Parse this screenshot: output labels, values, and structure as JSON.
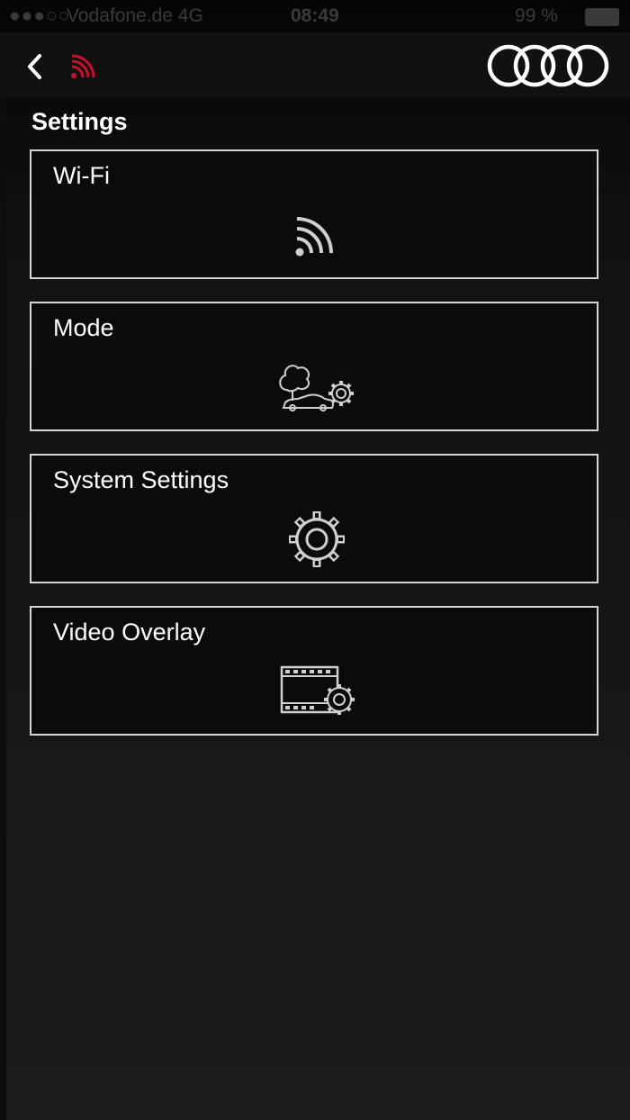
{
  "status_bar": {
    "signal": "●●●○○",
    "carrier": "Vodafone.de   4G",
    "time": "08:49",
    "battery": "99 %"
  },
  "navbar": {
    "back_icon": "chevron-left-icon",
    "connection_icon": "wifi-signal-icon",
    "logo": "audi-rings-logo",
    "accent_color": "#c8102e"
  },
  "section_title": "Settings",
  "items": [
    {
      "label": "Wi-Fi",
      "icon": "wifi-icon"
    },
    {
      "label": "Mode",
      "icon": "tree-car-gear-icon"
    },
    {
      "label": "System Settings",
      "icon": "gear-icon"
    },
    {
      "label": "Video Overlay",
      "icon": "film-gear-icon"
    }
  ]
}
